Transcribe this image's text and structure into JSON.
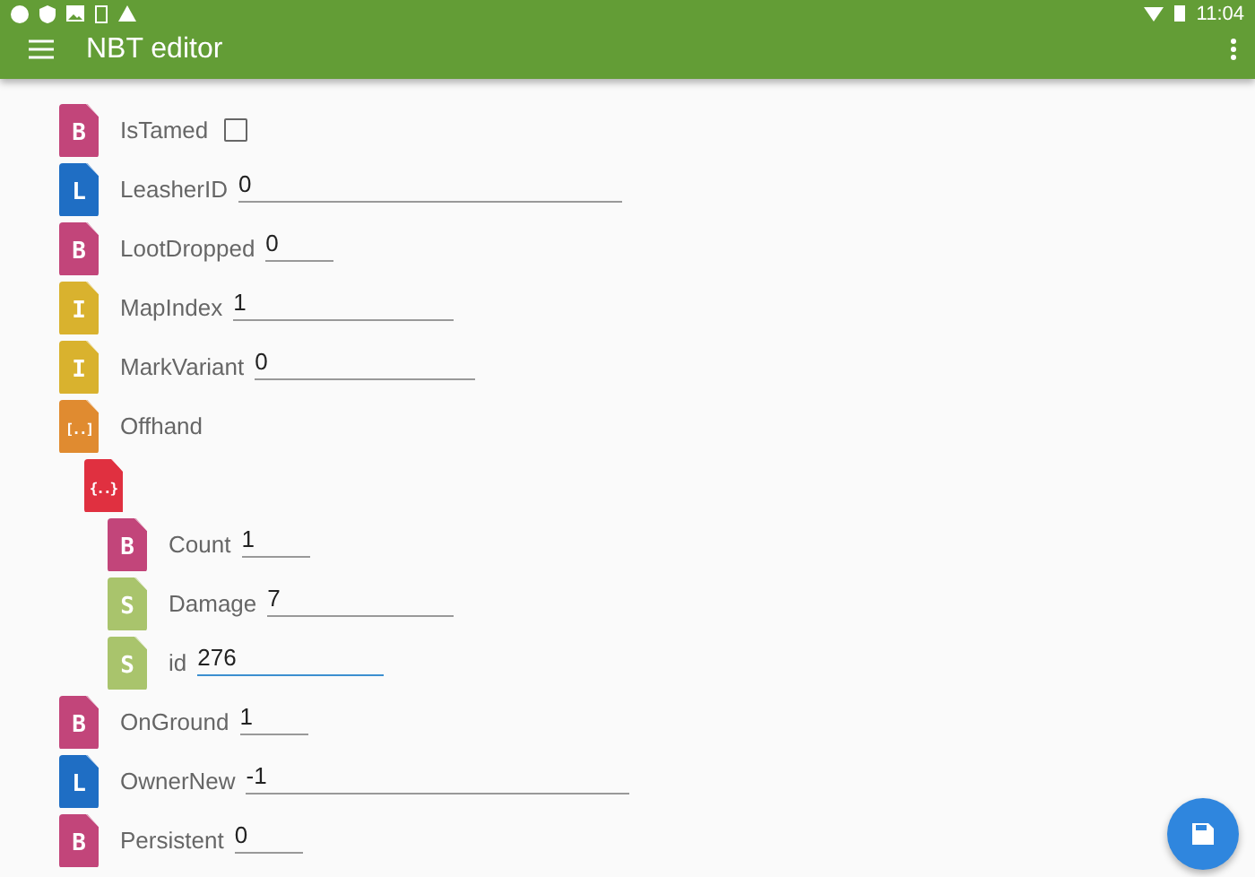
{
  "status_bar": {
    "time": "11:04"
  },
  "toolbar": {
    "title": "NBT editor"
  },
  "tree": [
    {
      "kind": "checkbox",
      "tag": "B",
      "color": "#c2457a",
      "name": "IsTamed",
      "checked": false
    },
    {
      "kind": "long",
      "tag": "L",
      "color": "#1f6ec4",
      "name": "LeasherID",
      "value": "0",
      "focused": false
    },
    {
      "kind": "byte",
      "tag": "B",
      "color": "#c2457a",
      "name": "LootDropped",
      "value": "0",
      "focused": false
    },
    {
      "kind": "int",
      "tag": "I",
      "color": "#d9b22e",
      "name": "MapIndex",
      "value": "1",
      "focused": false
    },
    {
      "kind": "int",
      "tag": "I",
      "color": "#d9b22e",
      "name": "MarkVariant",
      "value": "0",
      "focused": false
    },
    {
      "kind": "list",
      "tag": "[..]",
      "color": "#e08b30",
      "name": "Offhand",
      "children": [
        {
          "kind": "compound",
          "tag": "{..}",
          "color": "#e03040",
          "children": [
            {
              "kind": "byte",
              "tag": "B",
              "color": "#c2457a",
              "name": "Count",
              "value": "1",
              "focused": false
            },
            {
              "kind": "short",
              "tag": "S",
              "color": "#a9c46c",
              "name": "Damage",
              "value": "7",
              "focused": false
            },
            {
              "kind": "short",
              "tag": "S",
              "color": "#a9c46c",
              "name": "id",
              "value": "276",
              "focused": true
            }
          ]
        }
      ]
    },
    {
      "kind": "byte",
      "tag": "B",
      "color": "#c2457a",
      "name": "OnGround",
      "value": "1",
      "focused": false
    },
    {
      "kind": "long",
      "tag": "L",
      "color": "#1f6ec4",
      "name": "OwnerNew",
      "value": "-1",
      "focused": false
    },
    {
      "kind": "byte",
      "tag": "B",
      "color": "#c2457a",
      "name": "Persistent",
      "value": "0",
      "focused": false
    }
  ]
}
